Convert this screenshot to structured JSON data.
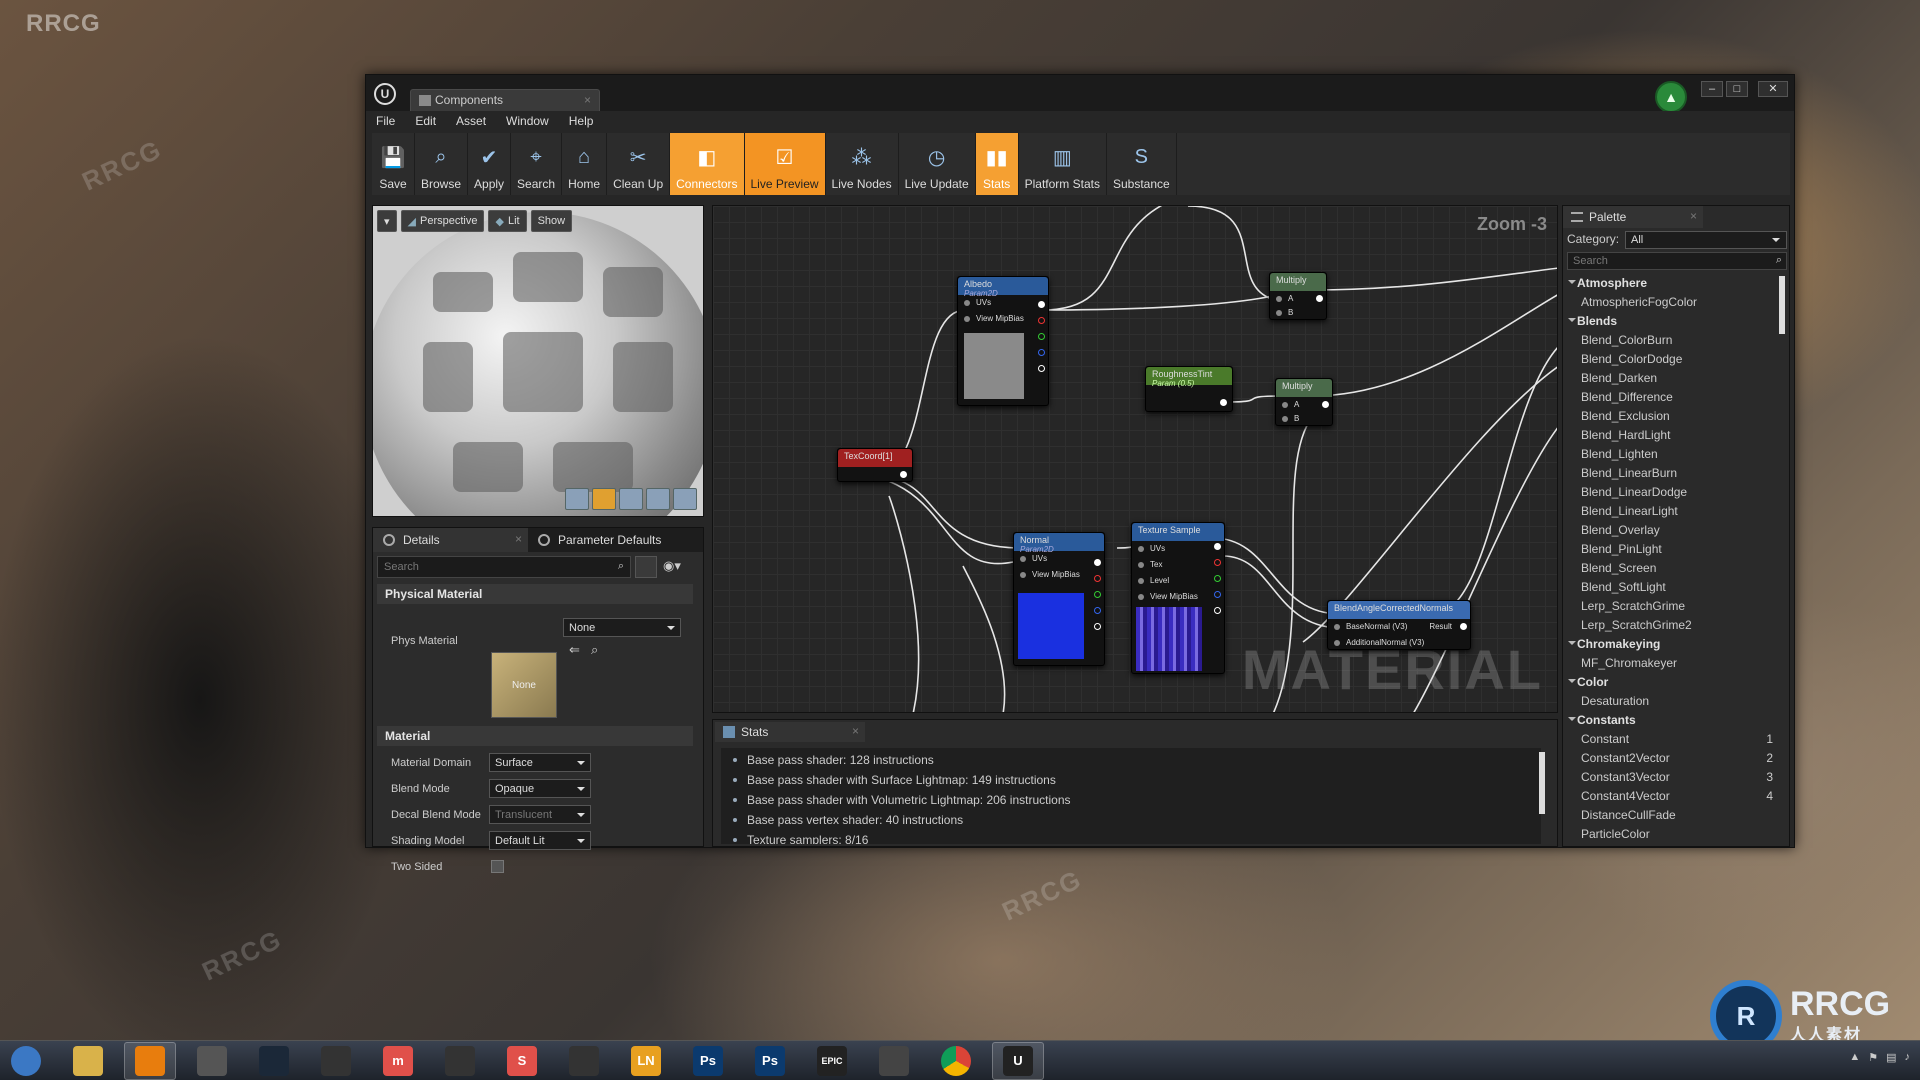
{
  "desktop": {
    "watermark": "RRCG",
    "logo_main": "RRCG",
    "logo_sub": "人人素材"
  },
  "window": {
    "tab_title": "Components",
    "menu": [
      "File",
      "Edit",
      "Asset",
      "Window",
      "Help"
    ],
    "toolbar": [
      {
        "label": "Save",
        "icon": "save-icon"
      },
      {
        "label": "Browse",
        "icon": "browse-icon"
      },
      {
        "label": "Apply",
        "icon": "apply-icon"
      },
      {
        "label": "Search",
        "icon": "search-icon"
      },
      {
        "label": "Home",
        "icon": "home-icon"
      },
      {
        "label": "Clean Up",
        "icon": "cleanup-icon"
      },
      {
        "label": "Connectors",
        "icon": "connectors-icon",
        "state": "active"
      },
      {
        "label": "Live Preview",
        "icon": "live-preview-icon",
        "state": "active"
      },
      {
        "label": "Live Nodes",
        "icon": "live-nodes-icon"
      },
      {
        "label": "Live Update",
        "icon": "live-update-icon"
      },
      {
        "label": "Stats",
        "icon": "stats-icon",
        "state": "active"
      },
      {
        "label": "Platform Stats",
        "icon": "platform-stats-icon"
      },
      {
        "label": "Substance",
        "icon": "substance-icon"
      }
    ]
  },
  "viewport": {
    "perspective": "Perspective",
    "lit": "Lit",
    "show": "Show"
  },
  "details": {
    "tab_details": "Details",
    "tab_params": "Parameter Defaults",
    "search_placeholder": "Search",
    "physical_section": "Physical Material",
    "phys_label": "Phys Material",
    "phys_thumb": "None",
    "phys_value": "None",
    "material_section": "Material",
    "props": [
      {
        "label": "Material Domain",
        "value": "Surface"
      },
      {
        "label": "Blend Mode",
        "value": "Opaque"
      },
      {
        "label": "Decal Blend Mode",
        "value": "Translucent"
      },
      {
        "label": "Shading Model",
        "value": "Default Lit"
      },
      {
        "label": "Two Sided",
        "value": ""
      }
    ]
  },
  "graph": {
    "zoom": "Zoom -3",
    "watermark": "MATERIAL",
    "nodes": {
      "albedo": {
        "title": "Albedo",
        "sub": "Param2D",
        "pins": [
          "UVs",
          "View MipBias"
        ]
      },
      "normal": {
        "title": "Normal",
        "sub": "Param2D",
        "pins": [
          "UVs",
          "View MipBias"
        ]
      },
      "texsample": {
        "title": "Texture Sample",
        "pins": [
          "UVs",
          "Tex",
          "Level",
          "View MipBias"
        ]
      },
      "texcoord": {
        "title": "TexCoord[1]"
      },
      "rough": {
        "title": "RoughnessTint",
        "sub": "Param (0.5)"
      },
      "mult1": {
        "title": "Multiply",
        "pins": [
          "A",
          "B"
        ]
      },
      "mult2": {
        "title": "Multiply",
        "pins": [
          "A",
          "B"
        ]
      },
      "blend": {
        "title": "BlendAngleCorrectedNormals",
        "pins": [
          "BaseNormal (V3)",
          "AdditionalNormal (V3)"
        ],
        "out": "Result"
      }
    }
  },
  "stats": {
    "tab": "Stats",
    "lines": [
      "Base pass shader: 128 instructions",
      "Base pass shader with Surface Lightmap: 149 instructions",
      "Base pass shader with Volumetric Lightmap: 206 instructions",
      "Base pass vertex shader: 40 instructions",
      "Texture samplers: 8/16"
    ]
  },
  "palette": {
    "tab": "Palette",
    "category_label": "Category:",
    "category_value": "All",
    "search_placeholder": "Search",
    "items": [
      {
        "text": "Atmosphere",
        "cat": true
      },
      {
        "text": "AtmosphericFogColor"
      },
      {
        "text": "Blends",
        "cat": true
      },
      {
        "text": "Blend_ColorBurn"
      },
      {
        "text": "Blend_ColorDodge"
      },
      {
        "text": "Blend_Darken"
      },
      {
        "text": "Blend_Difference"
      },
      {
        "text": "Blend_Exclusion"
      },
      {
        "text": "Blend_HardLight"
      },
      {
        "text": "Blend_Lighten"
      },
      {
        "text": "Blend_LinearBurn"
      },
      {
        "text": "Blend_LinearDodge"
      },
      {
        "text": "Blend_LinearLight"
      },
      {
        "text": "Blend_Overlay"
      },
      {
        "text": "Blend_PinLight"
      },
      {
        "text": "Blend_Screen"
      },
      {
        "text": "Blend_SoftLight"
      },
      {
        "text": "Lerp_ScratchGrime"
      },
      {
        "text": "Lerp_ScratchGrime2"
      },
      {
        "text": "Chromakeying",
        "cat": true
      },
      {
        "text": "MF_Chromakeyer"
      },
      {
        "text": "Color",
        "cat": true
      },
      {
        "text": "Desaturation"
      },
      {
        "text": "Constants",
        "cat": true
      },
      {
        "text": "Constant",
        "hotkey": "1"
      },
      {
        "text": "Constant2Vector",
        "hotkey": "2"
      },
      {
        "text": "Constant3Vector",
        "hotkey": "3"
      },
      {
        "text": "Constant4Vector",
        "hotkey": "4"
      },
      {
        "text": "DistanceCullFade"
      },
      {
        "text": "ParticleColor"
      }
    ]
  },
  "taskbar": {
    "apps": [
      {
        "name": "start",
        "glyph": "",
        "color": "#3b78c4"
      },
      {
        "name": "explorer",
        "glyph": "",
        "color": "#d9b24a"
      },
      {
        "name": "blender",
        "glyph": "",
        "color": "#e87d0d",
        "active": true
      },
      {
        "name": "zbrush",
        "glyph": "",
        "color": "#555"
      },
      {
        "name": "steam",
        "glyph": "",
        "color": "#1b2838"
      },
      {
        "name": "marmoset",
        "glyph": "",
        "color": "#333"
      },
      {
        "name": "marvelous",
        "glyph": "m",
        "color": "#e0504a"
      },
      {
        "name": "app-heart",
        "glyph": "",
        "color": "#333"
      },
      {
        "name": "substance-painter",
        "glyph": "S",
        "color": "#e0504a"
      },
      {
        "name": "obs",
        "glyph": "",
        "color": "#333"
      },
      {
        "name": "ln",
        "glyph": "LN",
        "color": "#e8a020"
      },
      {
        "name": "photoshop-1",
        "glyph": "Ps",
        "color": "#0b3a6e"
      },
      {
        "name": "photoshop-2",
        "glyph": "Ps",
        "color": "#0b3a6e"
      },
      {
        "name": "epic",
        "glyph": "EPIC",
        "color": "#222"
      },
      {
        "name": "app-k",
        "glyph": "",
        "color": "#444"
      },
      {
        "name": "chrome",
        "glyph": "",
        "color": "#4285f4"
      },
      {
        "name": "unreal",
        "glyph": "U",
        "color": "#222",
        "active": true
      }
    ]
  }
}
